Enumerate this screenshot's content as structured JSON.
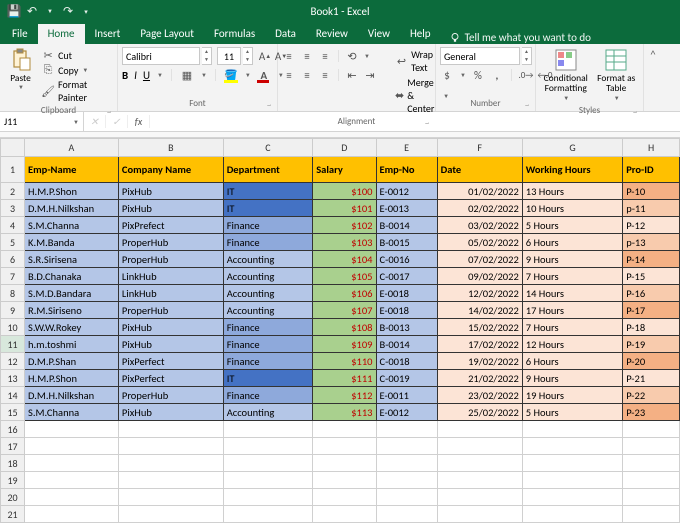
{
  "title": "Book1 - Excel",
  "qat": {
    "save": "💾",
    "undo": "↶",
    "redo": "↷",
    "more": "▾"
  },
  "tabs": [
    "File",
    "Home",
    "Insert",
    "Page Layout",
    "Formulas",
    "Data",
    "Review",
    "View",
    "Help"
  ],
  "active_tab": "Home",
  "tell_me": "Tell me what you want to do",
  "ribbon": {
    "clipboard": {
      "paste": "Paste",
      "cut": "Cut",
      "copy": "Copy",
      "painter": "Format Painter",
      "label": "Clipboard"
    },
    "font": {
      "name": "Calibri",
      "size": "11",
      "bold": "B",
      "italic": "I",
      "underline": "U",
      "label": "Font"
    },
    "align": {
      "wrap": "Wrap Text",
      "merge": "Merge & Center",
      "label": "Alignment"
    },
    "number": {
      "format": "General",
      "label": "Number"
    },
    "styles": {
      "cond": "Conditional Formatting",
      "table": "Format as Table",
      "label": "Styles"
    }
  },
  "name_box": "J11",
  "col_headers": [
    "A",
    "B",
    "C",
    "D",
    "E",
    "F",
    "G",
    "H"
  ],
  "table_headers": [
    "Emp-Name",
    "Company Name",
    "Department",
    "Salary",
    "Emp-No",
    "Date",
    "Working Hours",
    "Pro-ID"
  ],
  "rows": [
    {
      "emp": "H.M.P.Shon",
      "co": "PixHub",
      "dep": "IT",
      "sal": "$100",
      "eno": "E-0012",
      "date": "01/02/2022",
      "wh": "13 Hours",
      "pid": "P-10",
      "dc": "bg-blue-dk",
      "oc": "bg-orange-dk"
    },
    {
      "emp": "D.M.H.Nilkshan",
      "co": "PixHub",
      "dep": "IT",
      "sal": "$101",
      "eno": "E-0013",
      "date": "02/02/2022",
      "wh": "10 Hours",
      "pid": "p-11",
      "dc": "bg-blue-dk",
      "oc": "bg-orange-md"
    },
    {
      "emp": "S.M.Channa",
      "co": "PixPrefect",
      "dep": "Finance",
      "sal": "$102",
      "eno": "B-0014",
      "date": "03/02/2022",
      "wh": "5 Hours",
      "pid": "P-12",
      "dc": "bg-blue-md",
      "oc": "bg-orange-lt"
    },
    {
      "emp": "K.M.Banda",
      "co": "ProperHub",
      "dep": "Finance",
      "sal": "$103",
      "eno": "B-0015",
      "date": "05/02/2022",
      "wh": "6 Hours",
      "pid": "p-13",
      "dc": "bg-blue-md",
      "oc": "bg-orange-md"
    },
    {
      "emp": "S.R.Sirisena",
      "co": "ProperHub",
      "dep": "Accounting",
      "sal": "$104",
      "eno": "C-0016",
      "date": "07/02/2022",
      "wh": "9 Hours",
      "pid": "P-14",
      "dc": "bg-blue-lt",
      "oc": "bg-orange-dk"
    },
    {
      "emp": "B.D.Chanaka",
      "co": "LinkHub",
      "dep": "Accounting",
      "sal": "$105",
      "eno": "C-0017",
      "date": "09/02/2022",
      "wh": "7 Hours",
      "pid": "P-15",
      "dc": "bg-blue-lt",
      "oc": "bg-orange-lt"
    },
    {
      "emp": "S.M.D.Bandara",
      "co": "LinkHub",
      "dep": "Accounting",
      "sal": "$106",
      "eno": "E-0018",
      "date": "12/02/2022",
      "wh": "14 Hours",
      "pid": "P-16",
      "dc": "bg-blue-lt",
      "oc": "bg-orange-md"
    },
    {
      "emp": "R.M.Siriseno",
      "co": "ProperHub",
      "dep": "Accounting",
      "sal": "$107",
      "eno": "E-0018",
      "date": "14/02/2022",
      "wh": "17 Hours",
      "pid": "P-17",
      "dc": "bg-blue-lt",
      "oc": "bg-orange-dk"
    },
    {
      "emp": "S.W.W.Rokey",
      "co": "PixHub",
      "dep": "Finance",
      "sal": "$108",
      "eno": "B-0013",
      "date": "15/02/2022",
      "wh": "7 Hours",
      "pid": "P-18",
      "dc": "bg-blue-md",
      "oc": "bg-orange-lt"
    },
    {
      "emp": "h.m.toshmi",
      "co": "PixHub",
      "dep": "Finance",
      "sal": "$109",
      "eno": "B-0014",
      "date": "17/02/2022",
      "wh": "12  Hours",
      "pid": "P-19",
      "dc": "bg-blue-md",
      "oc": "bg-orange-md"
    },
    {
      "emp": "D.M.P.Shan",
      "co": "PixPerfect",
      "dep": "Finance",
      "sal": "$110",
      "eno": "C-0018",
      "date": "19/02/2022",
      "wh": "6  Hours",
      "pid": "P-20",
      "dc": "bg-blue-md",
      "oc": "bg-orange-dk"
    },
    {
      "emp": "H.M.P.Shon",
      "co": "PixPerfect",
      "dep": "IT",
      "sal": "$111",
      "eno": "C-0019",
      "date": "21/02/2022",
      "wh": "9 Hours",
      "pid": "P-21",
      "dc": "bg-blue-dk",
      "oc": "bg-orange-lt"
    },
    {
      "emp": "D.M.H.Nilkshan",
      "co": "ProperHub",
      "dep": "Finance",
      "sal": "$112",
      "eno": "E-0011",
      "date": "23/02/2022",
      "wh": "19 Hours",
      "pid": "P-22",
      "dc": "bg-blue-md",
      "oc": "bg-orange-md"
    },
    {
      "emp": "S.M.Channa",
      "co": "PixHub",
      "dep": "Accounting",
      "sal": "$113",
      "eno": "E-0012",
      "date": "25/02/2022",
      "wh": "5 Hours",
      "pid": "P-23",
      "dc": "bg-blue-lt",
      "oc": "bg-orange-dk"
    }
  ],
  "empty_row_start": 16,
  "empty_row_end": 21,
  "selected_row": 11
}
